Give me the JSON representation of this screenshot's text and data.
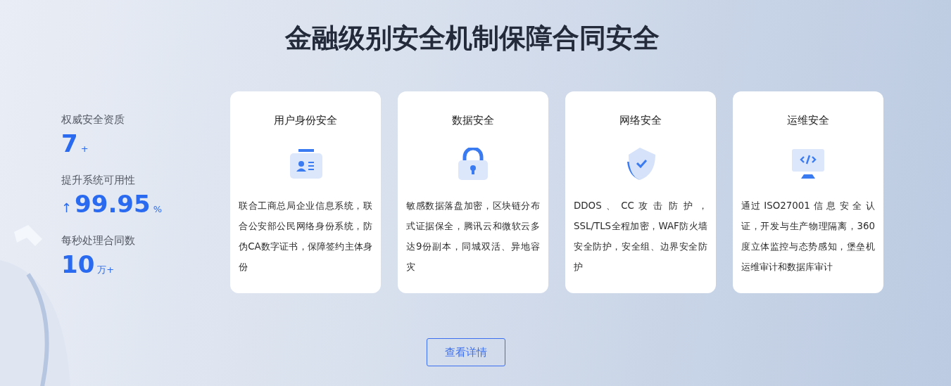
{
  "title": "金融级别安全机制保障合同安全",
  "stats": [
    {
      "label": "权威安全资质",
      "value": "7",
      "unit": "+"
    },
    {
      "label": "提升系统可用性",
      "prefix": "↑",
      "value": "99.95",
      "unit": "%"
    },
    {
      "label": "每秒处理合同数",
      "value": "10",
      "unit": "万+"
    }
  ],
  "cards": [
    {
      "title": "用户身份安全",
      "text": "联合工商总局企业信息系统，联合公安部公民网络身份系统，防伪CA数字证书，保障签约主体身份"
    },
    {
      "title": "数据安全",
      "text": "敏感数据落盘加密，区块链分布式证据保全，腾讯云和微软云多达9份副本，同城双活、异地容灾"
    },
    {
      "title": "网络安全",
      "text": "DDOS 、 CC 攻 击 防 护 ，SSL/TLS全程加密，WAF防火墙安全防护，安全组、边界安全防护"
    },
    {
      "title": "运维安全",
      "text": "通过 ISO27001 信 息 安 全 认证，开发与生产物理隔离，360度立体监控与态势感知，堡垒机运维审计和数据库审计"
    }
  ],
  "button": "查看详情"
}
